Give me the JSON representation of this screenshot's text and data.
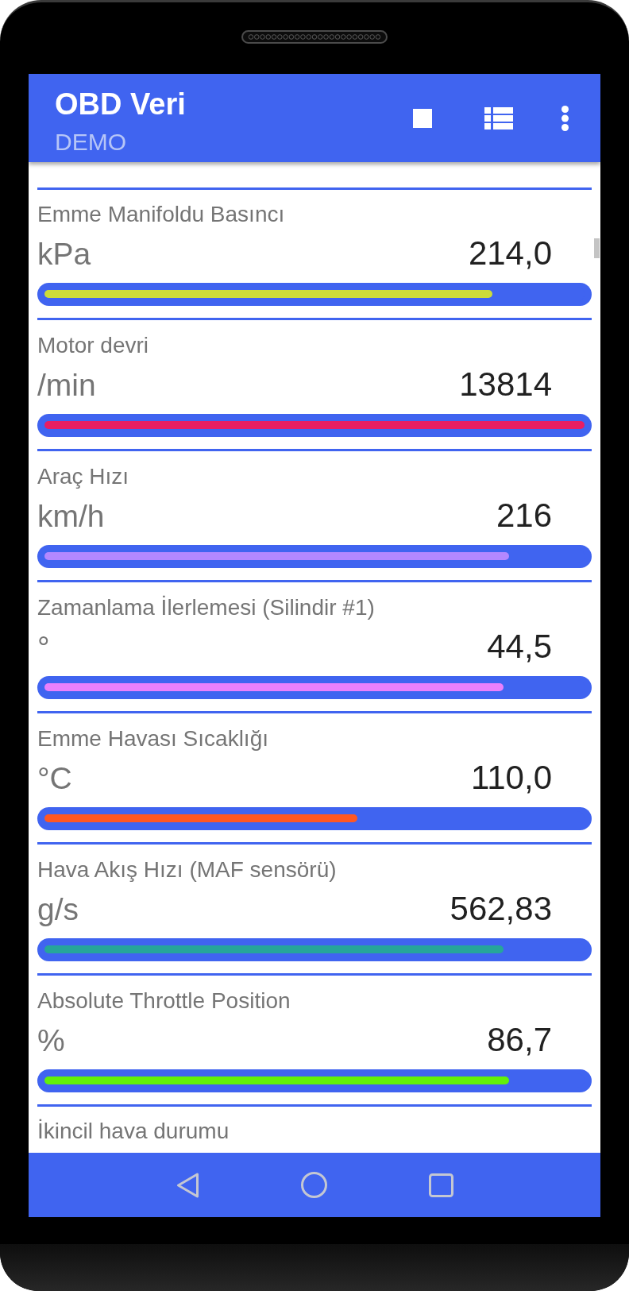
{
  "app_bar": {
    "title": "OBD Veri",
    "subtitle": "DEMO"
  },
  "readings": [
    {
      "name": "Emme Manifoldu Basıncı",
      "unit": "kPa",
      "value": "214,0",
      "level": 0.83,
      "color": "#cddc39"
    },
    {
      "name": "Motor devri",
      "unit": "/min",
      "value": "13814",
      "level": 1.0,
      "color": "#e91e63"
    },
    {
      "name": "Araç Hızı",
      "unit": "km/h",
      "value": "216",
      "level": 0.86,
      "color": "#b388ff"
    },
    {
      "name": "Zamanlama İlerlemesi (Silindir #1)",
      "unit": "°",
      "value": "44,5",
      "level": 0.85,
      "color": "#ea80fc"
    },
    {
      "name": "Emme Havası Sıcaklığı",
      "unit": "°C",
      "value": "110,0",
      "level": 0.58,
      "color": "#ff5722"
    },
    {
      "name": "Hava Akış Hızı (MAF sensörü)",
      "unit": "g/s",
      "value": "562,83",
      "level": 0.85,
      "color": "#26a69a"
    },
    {
      "name": "Absolute Throttle Position",
      "unit": "%",
      "value": "86,7",
      "level": 0.86,
      "color": "#62f00a"
    },
    {
      "name": "İkincil hava durumu"
    }
  ]
}
